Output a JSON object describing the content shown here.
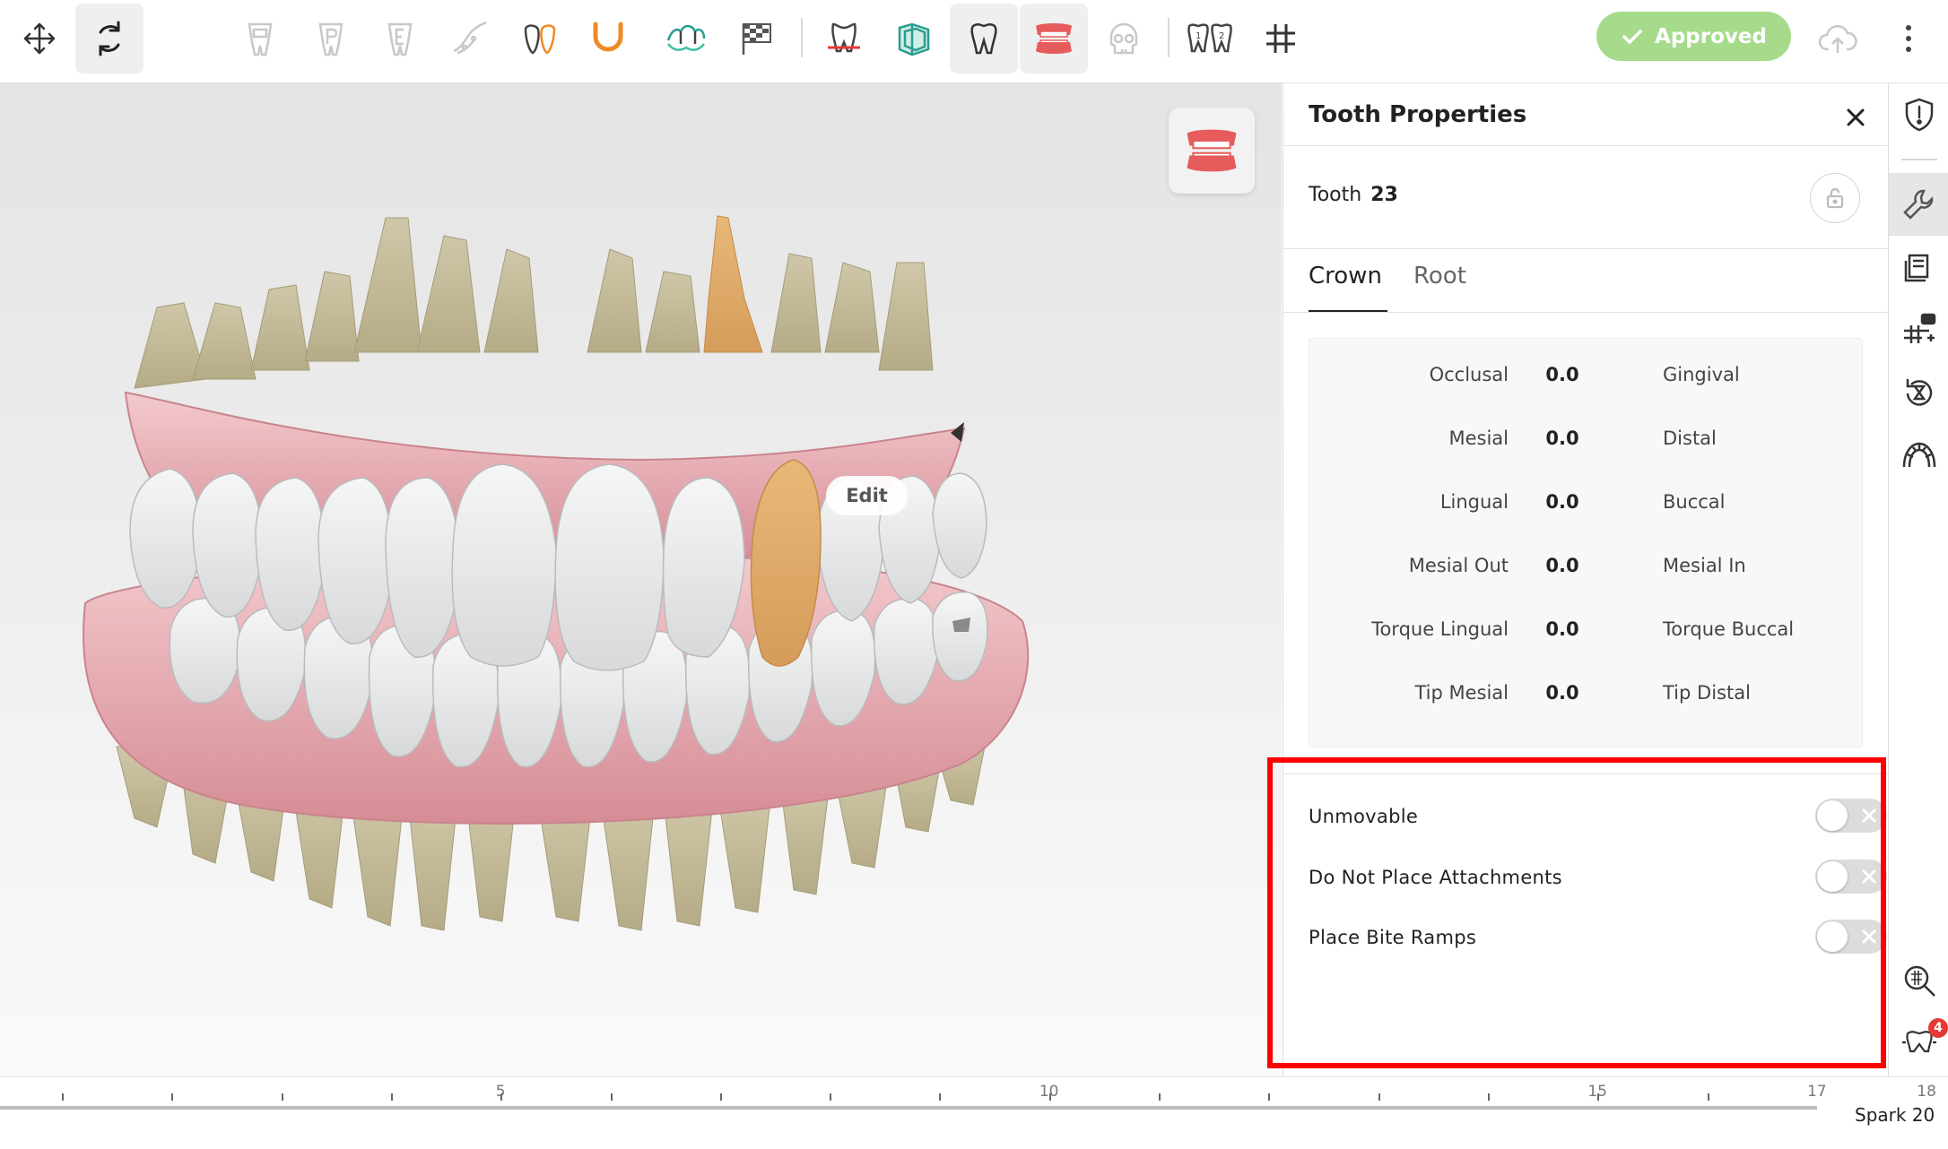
{
  "toolbar": {
    "tools": [
      {
        "icon": "move-arrows-icon"
      },
      {
        "icon": "rotate-icon"
      },
      {
        "icon": "tooth-crown-icon"
      },
      {
        "icon": "tooth-p-icon"
      },
      {
        "icon": "tooth-e-icon"
      },
      {
        "icon": "gum-line-icon"
      },
      {
        "icon": "tooth-pair-icon"
      },
      {
        "icon": "arch-wire-icon"
      },
      {
        "icon": "occlusion-teeth-icon"
      },
      {
        "icon": "checkered-flag-icon"
      },
      {
        "icon": "tooth-cut-icon"
      },
      {
        "icon": "aligner-layers-icon"
      },
      {
        "icon": "single-tooth-icon"
      },
      {
        "icon": "dentures-icon"
      },
      {
        "icon": "skull-icon"
      },
      {
        "icon": "tooth-numbering-icon"
      },
      {
        "icon": "grid-icon"
      }
    ],
    "approved_label": "Approved"
  },
  "viewport": {
    "edit_label": "Edit"
  },
  "panel": {
    "title": "Tooth Properties",
    "tooth_label": "Tooth",
    "tooth_number": "23",
    "tabs": [
      "Crown",
      "Root"
    ],
    "active_tab": "Crown",
    "params": [
      {
        "left": "Occlusal",
        "value": "0.0",
        "right": "Gingival"
      },
      {
        "left": "Mesial",
        "value": "0.0",
        "right": "Distal"
      },
      {
        "left": "Lingual",
        "value": "0.0",
        "right": "Buccal"
      },
      {
        "left": "Mesial Out",
        "value": "0.0",
        "right": "Mesial In"
      },
      {
        "left": "Torque Lingual",
        "value": "0.0",
        "right": "Torque Buccal"
      },
      {
        "left": "Tip Mesial",
        "value": "0.0",
        "right": "Tip Distal"
      }
    ],
    "options": [
      {
        "label": "Unmovable",
        "on": false
      },
      {
        "label": "Do Not Place Attachments",
        "on": false
      },
      {
        "label": "Place Bite Ramps",
        "on": false
      }
    ]
  },
  "sidebar": {
    "badge_count": "4"
  },
  "timeline": {
    "labels": [
      {
        "stage": 5,
        "text": "5"
      },
      {
        "stage": 10,
        "text": "10"
      },
      {
        "stage": 15,
        "text": "15"
      },
      {
        "stage": 17,
        "text": "17"
      },
      {
        "stage": 18,
        "text": "18"
      }
    ],
    "stage_label": "Spark 20"
  },
  "colors": {
    "approved_green": "#a6db8b",
    "highlight_red": "#ff0000",
    "gum_pink": "#e3a3aa",
    "badge_red": "#e53935",
    "active_toolbar_orange": "#f08a24"
  }
}
